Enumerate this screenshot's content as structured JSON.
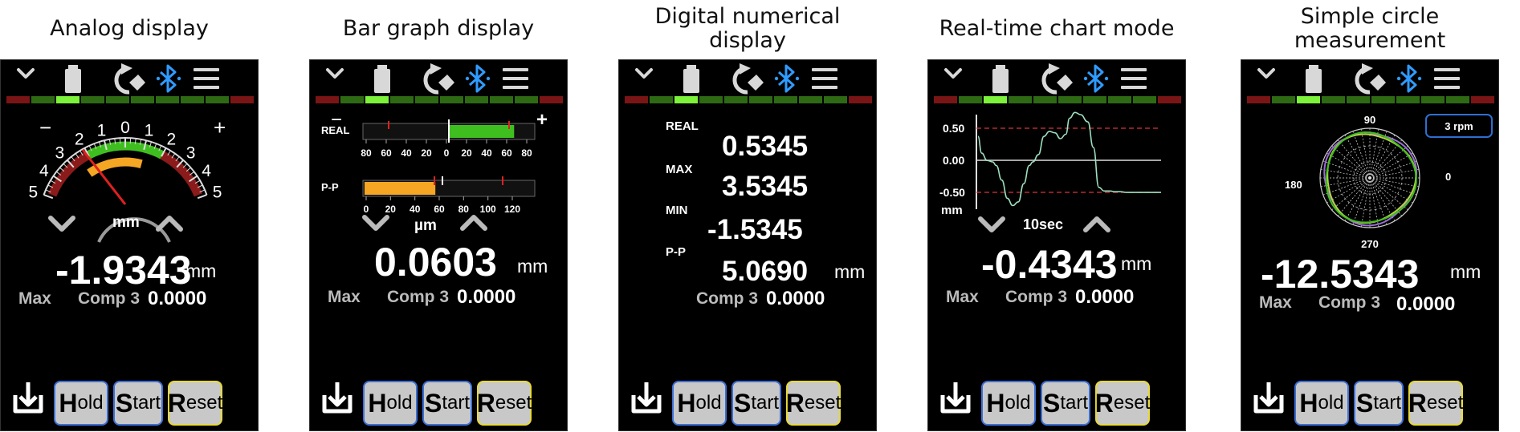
{
  "colors": {
    "accent_blue": "#2f9bff",
    "bar_green": "#3fbf1f",
    "bar_orange": "#f5a623",
    "arc_red": "#8b1a1a",
    "chart_line": "#9ee0c0",
    "button_border_blue": "#3d6fd6",
    "button_border_yellow": "#e8d93a"
  },
  "icons": {
    "chevron": "chevron-down-icon",
    "battery": "battery-icon",
    "rotate": "rotate-icon",
    "bluetooth": "bluetooth-icon",
    "menu": "hamburger-menu-icon",
    "download": "download-icon"
  },
  "buttons": {
    "hold_initial": "H",
    "hold_rest": "old",
    "start_initial": "S",
    "start_rest": "tart",
    "reset_initial": "R",
    "reset_rest": "eset"
  },
  "level_meter": {
    "segments": 10,
    "active_index": 2
  },
  "panels": {
    "analog": {
      "caption": "Analog display",
      "scale_minus": "−",
      "scale_plus": "+",
      "scale_labels": [
        "5",
        "4",
        "3",
        "2",
        "1",
        "0",
        "1",
        "2",
        "3",
        "4",
        "5"
      ],
      "unit_label": "mm",
      "reading": "-1.9343",
      "reading_unit": "mm",
      "max_label": "Max",
      "comp_label": "Comp 3",
      "comp_value": "0.0000"
    },
    "bar": {
      "caption": "Bar graph display",
      "minus": "−",
      "plus": "+",
      "real_label": "REAL",
      "real_ticks": [
        "80",
        "60",
        "40",
        "20",
        "0",
        "20",
        "40",
        "60",
        "80"
      ],
      "pp_label": "P-P",
      "pp_ticks": [
        "0",
        "20",
        "40",
        "60",
        "80",
        "100",
        "120"
      ],
      "pp_fill_fraction": 0.42,
      "real_fill_fraction": 0.43,
      "unit_label": "µm",
      "reading": "0.0603",
      "reading_unit": "mm",
      "max_label": "Max",
      "comp_label": "Comp 3",
      "comp_value": "0.0000"
    },
    "digital": {
      "caption": "Digital numerical\ndisplay",
      "rows": [
        {
          "label": "REAL",
          "value": "0.5345"
        },
        {
          "label": "MAX",
          "value": "3.5345"
        },
        {
          "label": "MIN",
          "value": "-1.5345"
        },
        {
          "label": "P-P",
          "value": "5.0690"
        }
      ],
      "unit": "mm",
      "comp_label": "Comp 3",
      "comp_value": "0.0000"
    },
    "chart": {
      "caption": "Real-time chart mode",
      "y_labels": [
        "0.50",
        "0.00",
        "-0.50"
      ],
      "unit_label": "mm",
      "time_label": "10sec",
      "reading": "-0.4343",
      "reading_unit": "mm",
      "max_label": "Max",
      "comp_label": "Comp 3",
      "comp_value": "0.0000"
    },
    "circle": {
      "caption": "Simple circle\nmeasurement",
      "rpm_label": "3 rpm",
      "angle_labels": {
        "top": "90",
        "left": "180",
        "right": "0",
        "bottom": "270"
      },
      "reading": "-12.5343",
      "reading_unit": "mm",
      "max_label": "Max",
      "comp_label": "Comp 3",
      "comp_value": "0.0000"
    }
  },
  "chart_data": {
    "type": "line",
    "y_ticks": [
      0.5,
      0.0,
      -0.5
    ],
    "ylim": [
      -0.65,
      0.65
    ],
    "series": [
      {
        "x": [
          0,
          2,
          5,
          8,
          10,
          13,
          16,
          19,
          22,
          25,
          28,
          30,
          33,
          36,
          39,
          42,
          45,
          48,
          50,
          53,
          56,
          60,
          63,
          66,
          69,
          72,
          75,
          78,
          81,
          84,
          87,
          90,
          93,
          96,
          100
        ],
        "values": [
          0.35,
          0.12,
          0.02,
          0.0,
          -0.05,
          -0.25,
          -0.5,
          -0.6,
          -0.55,
          -0.3,
          -0.05,
          0.0,
          0.1,
          0.35,
          0.42,
          0.4,
          0.32,
          0.38,
          0.6,
          0.68,
          0.65,
          0.55,
          0.2,
          -0.35,
          -0.4,
          -0.4,
          -0.41,
          -0.41,
          -0.42,
          -0.42,
          -0.42,
          -0.42,
          -0.42,
          -0.42,
          -0.42
        ]
      }
    ]
  }
}
